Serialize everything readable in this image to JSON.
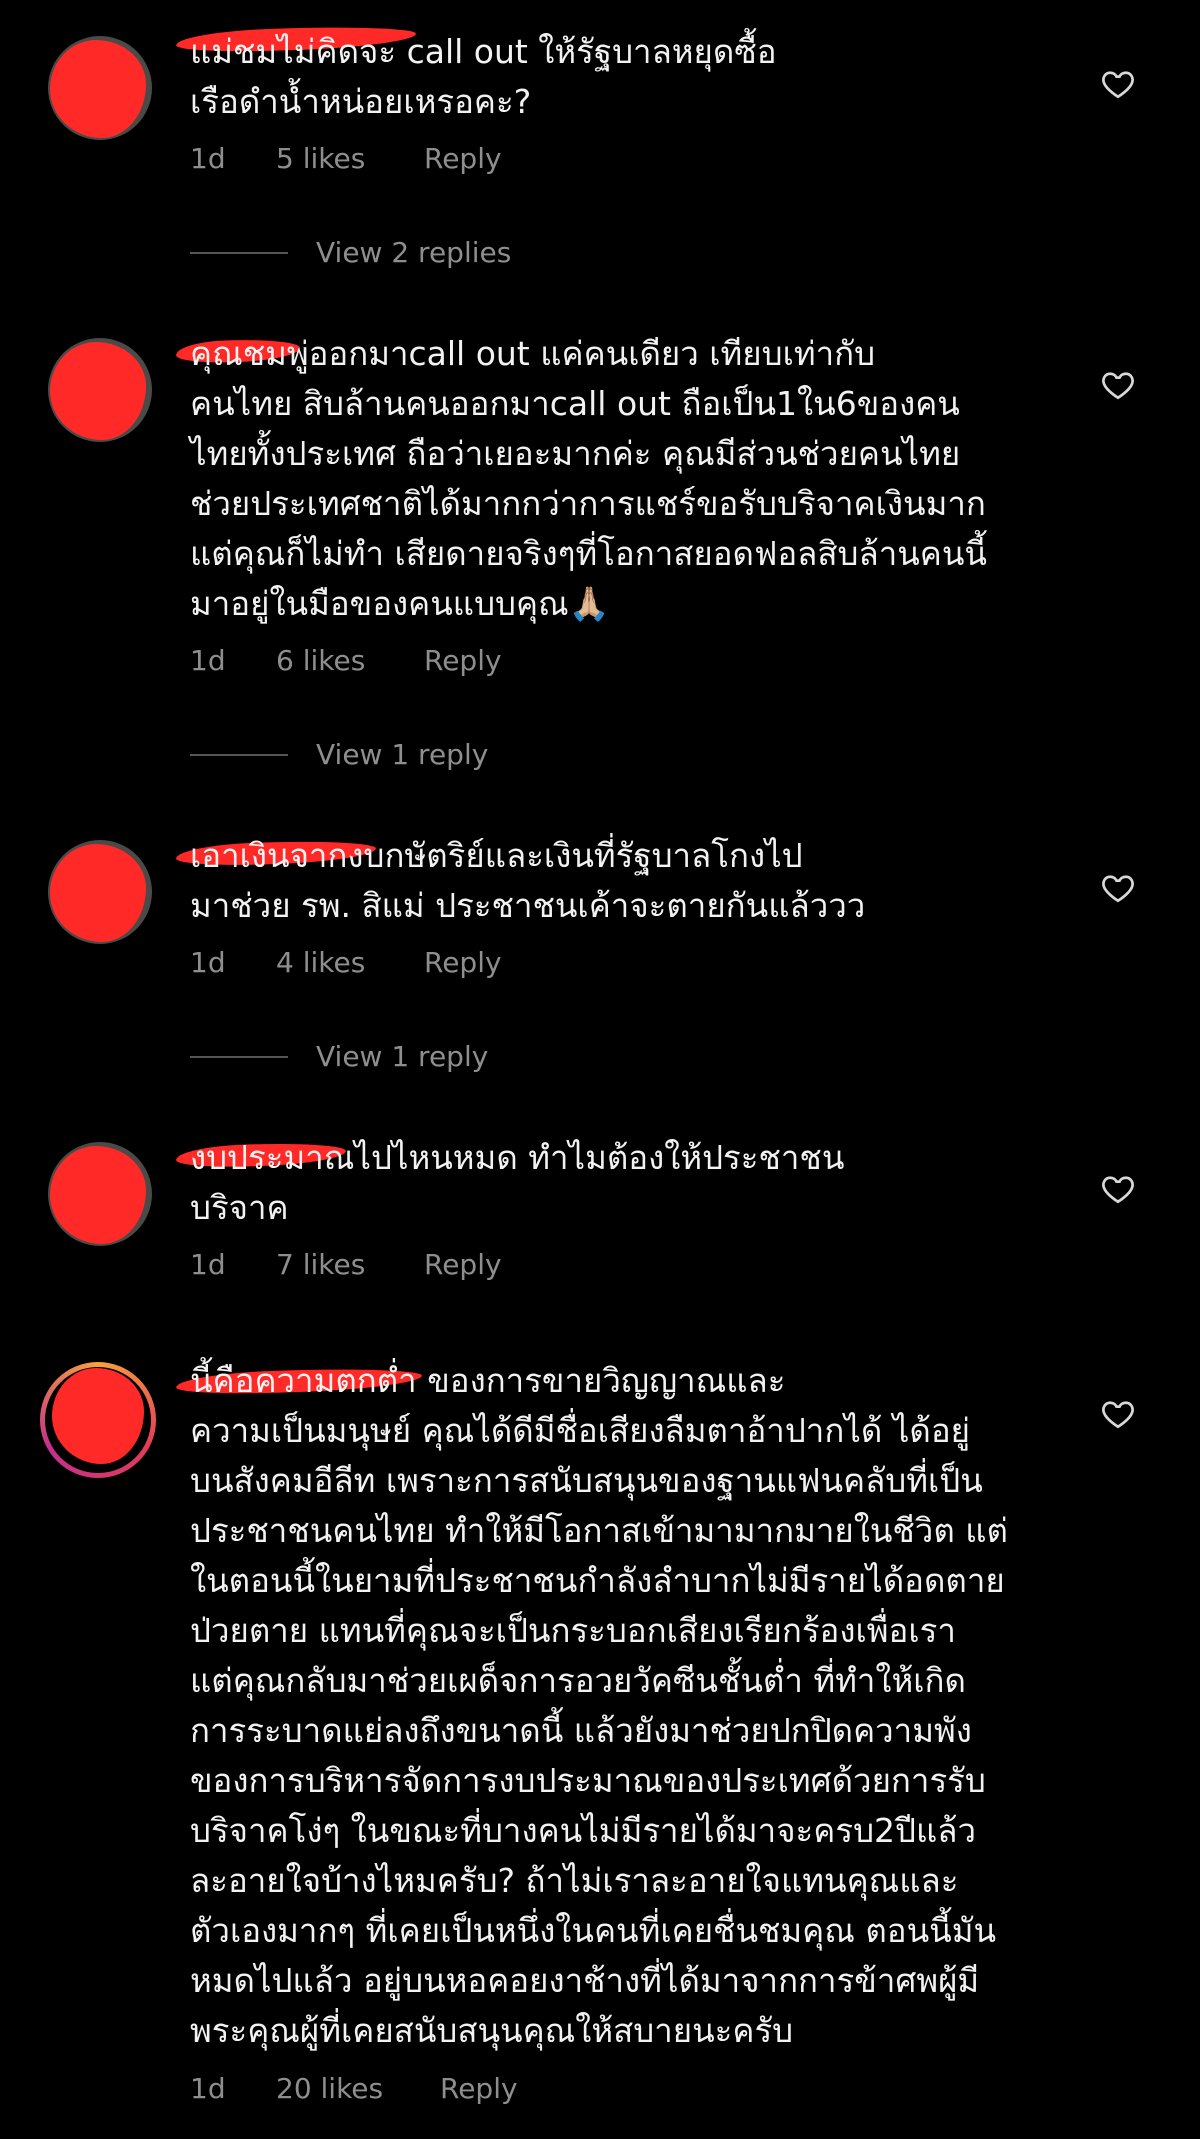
{
  "comments": [
    {
      "text": "แม่ชมไม่คิดจะ call out ให้รัฐบาลหยุดซื้อ\nเรือดำน้ำหน่อยเหรอคะ?",
      "time": "1d",
      "likes": "5 likes",
      "reply": "Reply",
      "view_replies": "View 2 replies"
    },
    {
      "text": "คุณชมพู่ออกมาcall out แค่คนเดียว เทียบเท่ากับ\nคนไทย สิบล้านคนออกมาcall out ถือเป็น1ใน6ของคน\nไทยทั้งประเทศ ถือว่าเยอะมากค่ะ คุณมีส่วนช่วยคนไทย\nช่วยประเทศชาติได้มากกว่าการแชร์ขอรับบริจาคเงินมาก\nแต่คุณก็ไม่ทำ เสียดายจริงๆที่โอกาสยอดฟอลสิบล้านคนนี้\nมาอยู่ในมือของคนแบบคุณ🙏🏼",
      "time": "1d",
      "likes": "6 likes",
      "reply": "Reply",
      "view_replies": "View 1 reply"
    },
    {
      "text": "เอาเงินจากงบกษัตริย์และเงินที่รัฐบาลโกงไป\nมาช่วย รพ. สิแม่ ประชาชนเค้าจะตายกันแล้ววว",
      "time": "1d",
      "likes": "4 likes",
      "reply": "Reply",
      "view_replies": "View 1 reply"
    },
    {
      "text": "งบประมาณไปไหนหมด ทำไมต้องให้ประชาชน\nบริจาค",
      "time": "1d",
      "likes": "7 likes",
      "reply": "Reply"
    },
    {
      "text": "นี้คือความตกต่ำ ของการขายวิญญาณและ\nความเป็นมนุษย์ คุณได้ดีมีชื่อเสียงลืมตาอ้าปากได้ ได้อยู่\nบนสังคมอีลีท เพราะการสนับสนุนของฐานแฟนคลับที่เป็น\nประชาชนคนไทย ทำให้มีโอกาสเข้ามามากมายในชีวิต แต่\nในตอนนี้ในยามที่ประชาชนกำลังลำบากไม่มีรายได้อดตาย\nป่วยตาย แทนที่คุณจะเป็นกระบอกเสียงเรียกร้องเพื่อเรา\nแต่คุณกลับมาช่วยเผด็จการอวยวัคซีนชั้นต่ำ ที่ทำให้เกิด\nการระบาดแย่ลงถึงขนาดนี้ แล้วยังมาช่วยปกปิดความพัง\nของการบริหารจัดการงบประมาณของประเทศด้วยการรับ\nบริจาคโง่ๆ ในขณะที่บางคนไม่มีรายได้มาจะครบ2ปีแล้ว\nละอายใจบ้างไหมครับ? ถ้าไม่เราละอายใจแทนคุณและ\nตัวเองมากๆ ที่เคยเป็นหนึ่งในคนที่เคยชื่นชมคุณ ตอนนี้มัน\nหมดไปแล้ว อยู่บนหอคอยงาช้างที่ได้มาจากการข้าศพผู้มี\nพระคุณผู้ที่เคยสนับสนุนคุณให้สบายนะครับ",
      "time": "1d",
      "likes": "20 likes",
      "reply": "Reply"
    }
  ]
}
